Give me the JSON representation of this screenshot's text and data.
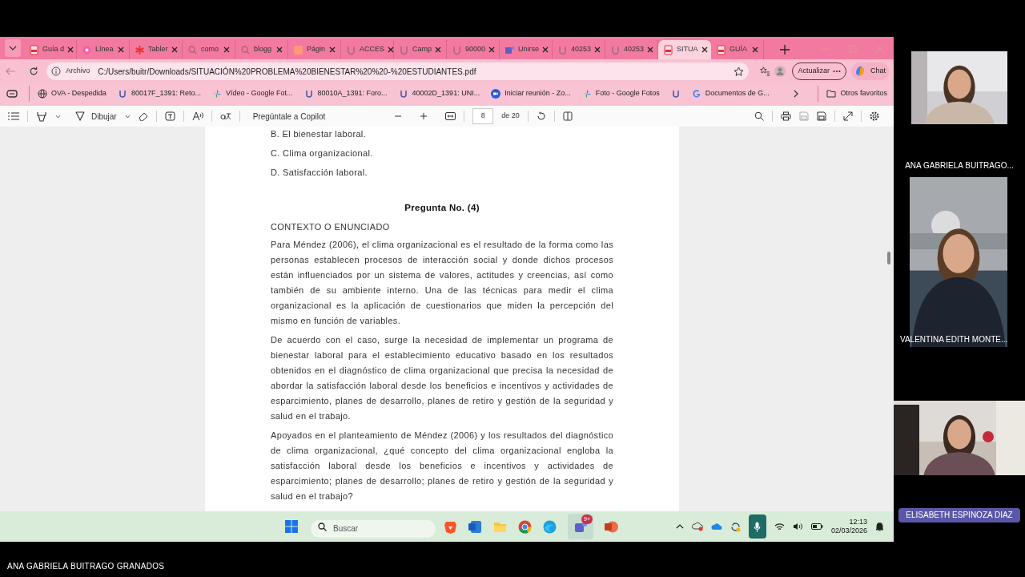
{
  "tabs": [
    {
      "label": "Guía d",
      "kind": "pdf",
      "selected": false
    },
    {
      "label": "Línea",
      "kind": "site",
      "selected": false
    },
    {
      "label": "Tabler",
      "kind": "star",
      "selected": false
    },
    {
      "label": "como",
      "kind": "search",
      "selected": false
    },
    {
      "label": "blogg",
      "kind": "search",
      "selected": false
    },
    {
      "label": "Págin",
      "kind": "orange",
      "selected": false
    },
    {
      "label": "ACCES",
      "kind": "u",
      "selected": false
    },
    {
      "label": "Camp",
      "kind": "u",
      "selected": false
    },
    {
      "label": "90000",
      "kind": "u",
      "selected": false
    },
    {
      "label": "Unirse",
      "kind": "teams",
      "selected": false
    },
    {
      "label": "40253",
      "kind": "u",
      "selected": false
    },
    {
      "label": "40253",
      "kind": "u",
      "selected": false
    },
    {
      "label": "SITUA",
      "kind": "pdf",
      "selected": true
    },
    {
      "label": "GUÍA",
      "kind": "pdf",
      "selected": false
    }
  ],
  "address_bar": {
    "scheme_label": "Archivo",
    "url": "C:/Users/buitr/Downloads/SITUACIÓN%20PROBLEMA%20BIENESTAR%20%20-%20ESTUDIANTES.pdf",
    "update_button": "Actualizar",
    "chat_button": "Chat"
  },
  "bookmarks": [
    {
      "label": "OVA - Despedida",
      "kind": "globe"
    },
    {
      "label": "80017F_1391: Reto...",
      "kind": "u"
    },
    {
      "label": "Vídeo - Google Fot...",
      "kind": "photos"
    },
    {
      "label": "80010A_1391: Foro...",
      "kind": "u"
    },
    {
      "label": "40002D_1391: UNI...",
      "kind": "u"
    },
    {
      "label": "Iniciar reunión - Zo...",
      "kind": "zoom"
    },
    {
      "label": "Foto - Google Fotos",
      "kind": "photos"
    },
    {
      "kind": "u"
    },
    {
      "label": "Documentos de G...",
      "kind": "google"
    }
  ],
  "other_bookmarks": "Otros favoritos",
  "pdf_toolbar": {
    "draw": "Dibujar",
    "copilot": "Pregúntale a Copilot",
    "page": "8",
    "page_total": "de 20"
  },
  "document": {
    "options": [
      "B. El bienestar laboral.",
      "C. Clima organizacional.",
      "D. Satisfacción laboral."
    ],
    "question_title": "Pregunta No. (4)",
    "section": "CONTEXTO O ENUNCIADO",
    "paragraphs": [
      "Para Méndez (2006), el clima organizacional es el resultado de la forma como las personas establecen procesos de interacción social y donde dichos procesos están influenciados por un sistema de valores, actitudes y creencias, así como también de su ambiente interno. Una de las técnicas para  medir el clima organizacional es la aplicación de cuestionarios que miden la percepción del mismo en función de variables.",
      "De acuerdo con el caso, surge la necesidad de implementar un programa de bienestar laboral para el establecimiento educativo basado en los resultados obtenidos en el diagnóstico de clima organizacional que precisa la necesidad de abordar la satisfacción laboral desde los beneficios e incentivos y actividades de esparcimiento, planes de desarrollo, planes de retiro y gestión de la seguridad y salud en el trabajo.",
      "Apoyados en el planteamiento de Méndez (2006) y los resultados del diagnóstico de clima organizacional, ¿qué concepto del clima organizacional engloba la satisfacción laboral desde los beneficios e incentivos y actividades de esparcimiento; planes de desarrollo; planes de retiro y gestión de la seguridad y salud en el trabajo?"
    ]
  },
  "taskbar": {
    "search_placeholder": "Buscar",
    "teams_badge": "9+",
    "time": "12:13",
    "date": "02/03/2026"
  },
  "participants": [
    {
      "name": "ANA GABRIELA BUITRAGO...",
      "kind": "small"
    },
    {
      "name": "VALENTINA EDITH MONTE...",
      "kind": "tall"
    },
    {
      "name": "ELISABETH ESPINOZA DIAZ",
      "kind": "wide"
    }
  ],
  "presenter_name": "ANA GABRIELA BUITRAGO GRANADOS"
}
